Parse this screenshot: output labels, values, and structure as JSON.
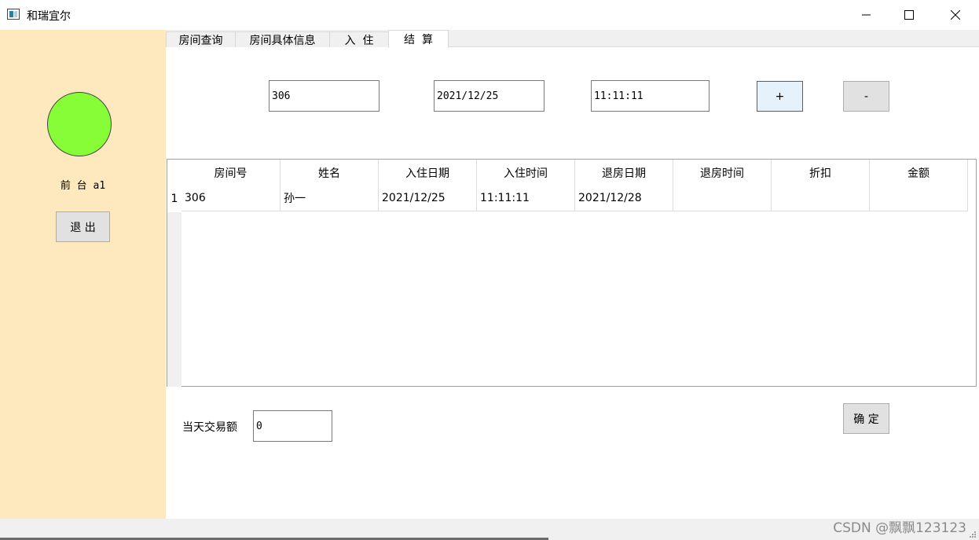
{
  "window": {
    "title": "和瑞宜尔",
    "icon": "app-window-icon"
  },
  "sidebar": {
    "user_label": "前 台 a1",
    "logout_label": "退 出",
    "status_color": "#87fd37"
  },
  "tabs": [
    {
      "label": "房间查询",
      "active": false
    },
    {
      "label": "房间具体信息",
      "active": false
    },
    {
      "label": "入  住",
      "active": false
    },
    {
      "label": "结  算",
      "active": true
    }
  ],
  "form": {
    "room_value": "306",
    "date_value": "2021/12/25",
    "time_value": "11:11:11",
    "plus_label": "+",
    "minus_label": "-"
  },
  "table": {
    "headers": [
      "房间号",
      "姓名",
      "入住日期",
      "入住时间",
      "退房日期",
      "退房时间",
      "折扣",
      "金额"
    ],
    "rows": [
      {
        "index": "1",
        "cells": [
          "306",
          "孙一",
          "2021/12/25",
          "11:11:11",
          "2021/12/28",
          "",
          "",
          ""
        ]
      }
    ]
  },
  "footer": {
    "daily_total_label": "当天交易额",
    "daily_total_value": "0",
    "confirm_label": "确 定"
  },
  "watermark": "CSDN @飘飘123123"
}
